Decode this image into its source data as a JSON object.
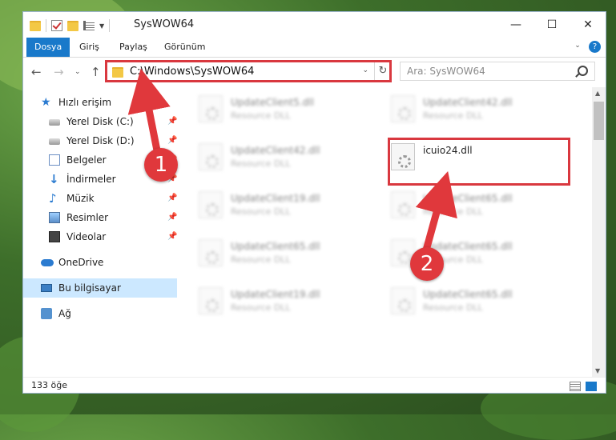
{
  "window": {
    "title": "SysWOW64",
    "controls": {
      "minimize": "—",
      "maximize": "☐",
      "close": "✕"
    }
  },
  "ribbon": {
    "tabs": [
      {
        "label": "Dosya",
        "active": true
      },
      {
        "label": "Giriş"
      },
      {
        "label": "Paylaş"
      },
      {
        "label": "Görünüm"
      }
    ],
    "help": "?"
  },
  "nav": {
    "address": "C:\\Windows\\SysWOW64",
    "search_placeholder": "Ara: SysWOW64"
  },
  "sidebar": {
    "items": [
      {
        "label": "Hızlı erişim",
        "icon": "star-icon"
      },
      {
        "label": "Yerel Disk (C:)",
        "icon": "disk-icon",
        "pinned": true
      },
      {
        "label": "Yerel Disk (D:)",
        "icon": "disk-icon",
        "pinned": true
      },
      {
        "label": "Belgeler",
        "icon": "documents-icon",
        "pinned": true
      },
      {
        "label": "İndirmeler",
        "icon": "download-icon",
        "pinned": true
      },
      {
        "label": "Müzik",
        "icon": "music-icon",
        "pinned": true
      },
      {
        "label": "Resimler",
        "icon": "pictures-icon",
        "pinned": true
      },
      {
        "label": "Videolar",
        "icon": "videos-icon",
        "pinned": true
      },
      {
        "label": "OneDrive",
        "icon": "cloud-icon"
      },
      {
        "label": "Bu bilgisayar",
        "icon": "computer-icon",
        "selected": true
      },
      {
        "label": "Ağ",
        "icon": "network-icon"
      }
    ]
  },
  "files": [
    {
      "name": "UpdateClient5.dll",
      "type": "Resource DLL"
    },
    {
      "name": "UpdateClient42.dll",
      "type": "Resource DLL"
    },
    {
      "name": "UpdateClient42.dll",
      "type": "Resource DLL"
    },
    {
      "name": "icuio24.dll",
      "type": "",
      "highlighted": true
    },
    {
      "name": "UpdateClient19.dll",
      "type": "Resource DLL"
    },
    {
      "name": "UpdateClient65.dll",
      "type": "Resource DLL"
    },
    {
      "name": "UpdateClient65.dll",
      "type": "Resource DLL"
    },
    {
      "name": "UpdateClient65.dll",
      "type": "Resource DLL"
    },
    {
      "name": "UpdateClient19.dll",
      "type": "Resource DLL"
    },
    {
      "name": "UpdateClient65.dll",
      "type": "Resource DLL"
    }
  ],
  "status": {
    "count": "133 öğe"
  },
  "annotations": {
    "step1": "1",
    "step2": "2",
    "color": "#e0383c"
  }
}
